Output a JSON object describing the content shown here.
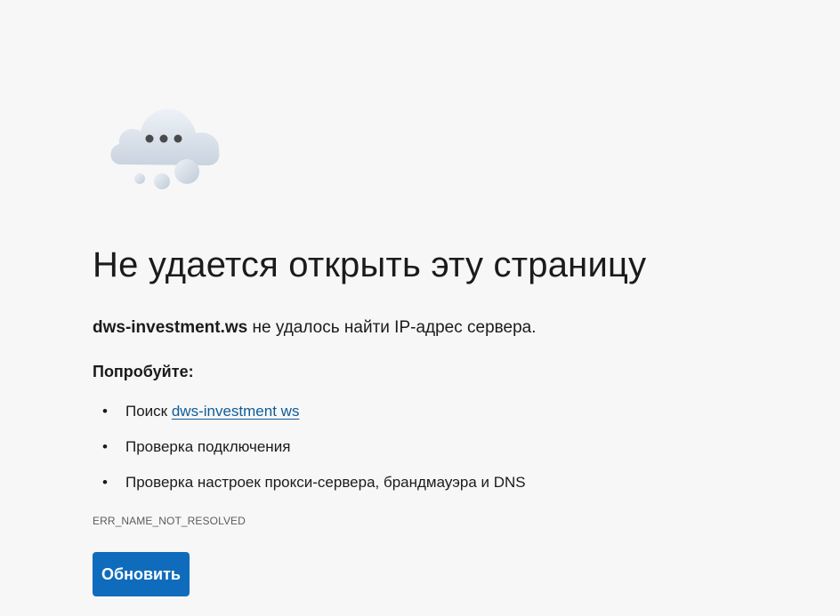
{
  "error_page": {
    "title": "Не удается открыть эту страницу",
    "host": "dws-investment.ws",
    "host_message": " не удалось найти IP-адрес сервера.",
    "try_heading": "Попробуйте:",
    "suggestions": {
      "search_prefix": "Поиск ",
      "search_link": "dws-investment ws",
      "check_connection": "Проверка подключения",
      "check_proxy": "Проверка настроек прокси-сервера, брандмауэра и DNS"
    },
    "error_code": "ERR_NAME_NOT_RESOLVED",
    "reload_label": "Обновить"
  },
  "icons": {
    "illustration": "cloud-with-dots-icon"
  },
  "colors": {
    "background": "#f7f7f7",
    "button": "#0f6cbd",
    "link": "#0f5c99",
    "text": "#1b1b1b"
  }
}
